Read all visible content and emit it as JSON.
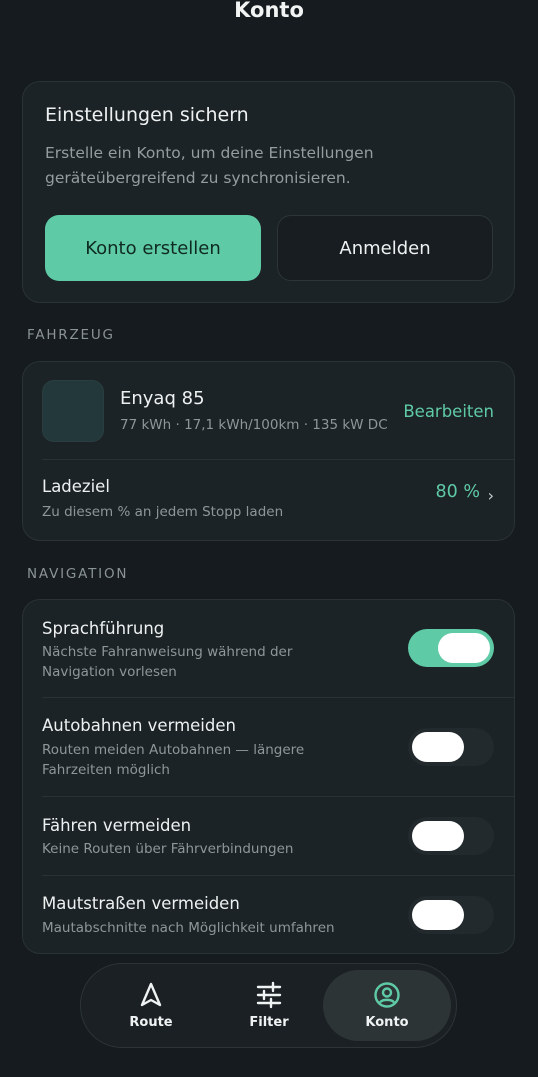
{
  "header": {
    "title": "Konto"
  },
  "account": {
    "title": "Einstellungen sichern",
    "description": "Erstelle ein Konto, um deine Einstellungen geräteübergreifend zu synchronisieren.",
    "create_label": "Konto erstellen",
    "login_label": "Anmelden"
  },
  "vehicle_section": {
    "label": "FAHRZEUG"
  },
  "vehicle": {
    "name": "Enyaq 85",
    "specs": "77 kWh · 17,1 kWh/100km · 135 kW DC",
    "edit_label": "Bearbeiten",
    "charge_target": {
      "title": "Ladeziel",
      "description": "Zu diesem % an jedem Stopp laden",
      "value": "80 %"
    }
  },
  "navigation_section": {
    "label": "NAVIGATION"
  },
  "navigation": {
    "items": [
      {
        "title": "Sprachführung",
        "description": "Nächste Fahranweisung während der Navigation vorlesen",
        "enabled": true
      },
      {
        "title": "Autobahnen vermeiden",
        "description": "Routen meiden Autobahnen — längere Fahrzeiten möglich",
        "enabled": false
      },
      {
        "title": "Fähren vermeiden",
        "description": "Keine Routen über Fährverbindungen",
        "enabled": false
      },
      {
        "title": "Mautstraßen vermeiden",
        "description": "Mautabschnitte nach Möglichkeit umfahren",
        "enabled": false
      }
    ]
  },
  "tabbar": {
    "tabs": [
      {
        "label": "Route",
        "icon": "navigation-arrow-icon",
        "active": false
      },
      {
        "label": "Filter",
        "icon": "sliders-icon",
        "active": false
      },
      {
        "label": "Konto",
        "icon": "user-circle-icon",
        "active": true
      }
    ]
  },
  "colors": {
    "accent": "#5fcaa6",
    "background": "#151b1e",
    "card": "#1c2326"
  }
}
